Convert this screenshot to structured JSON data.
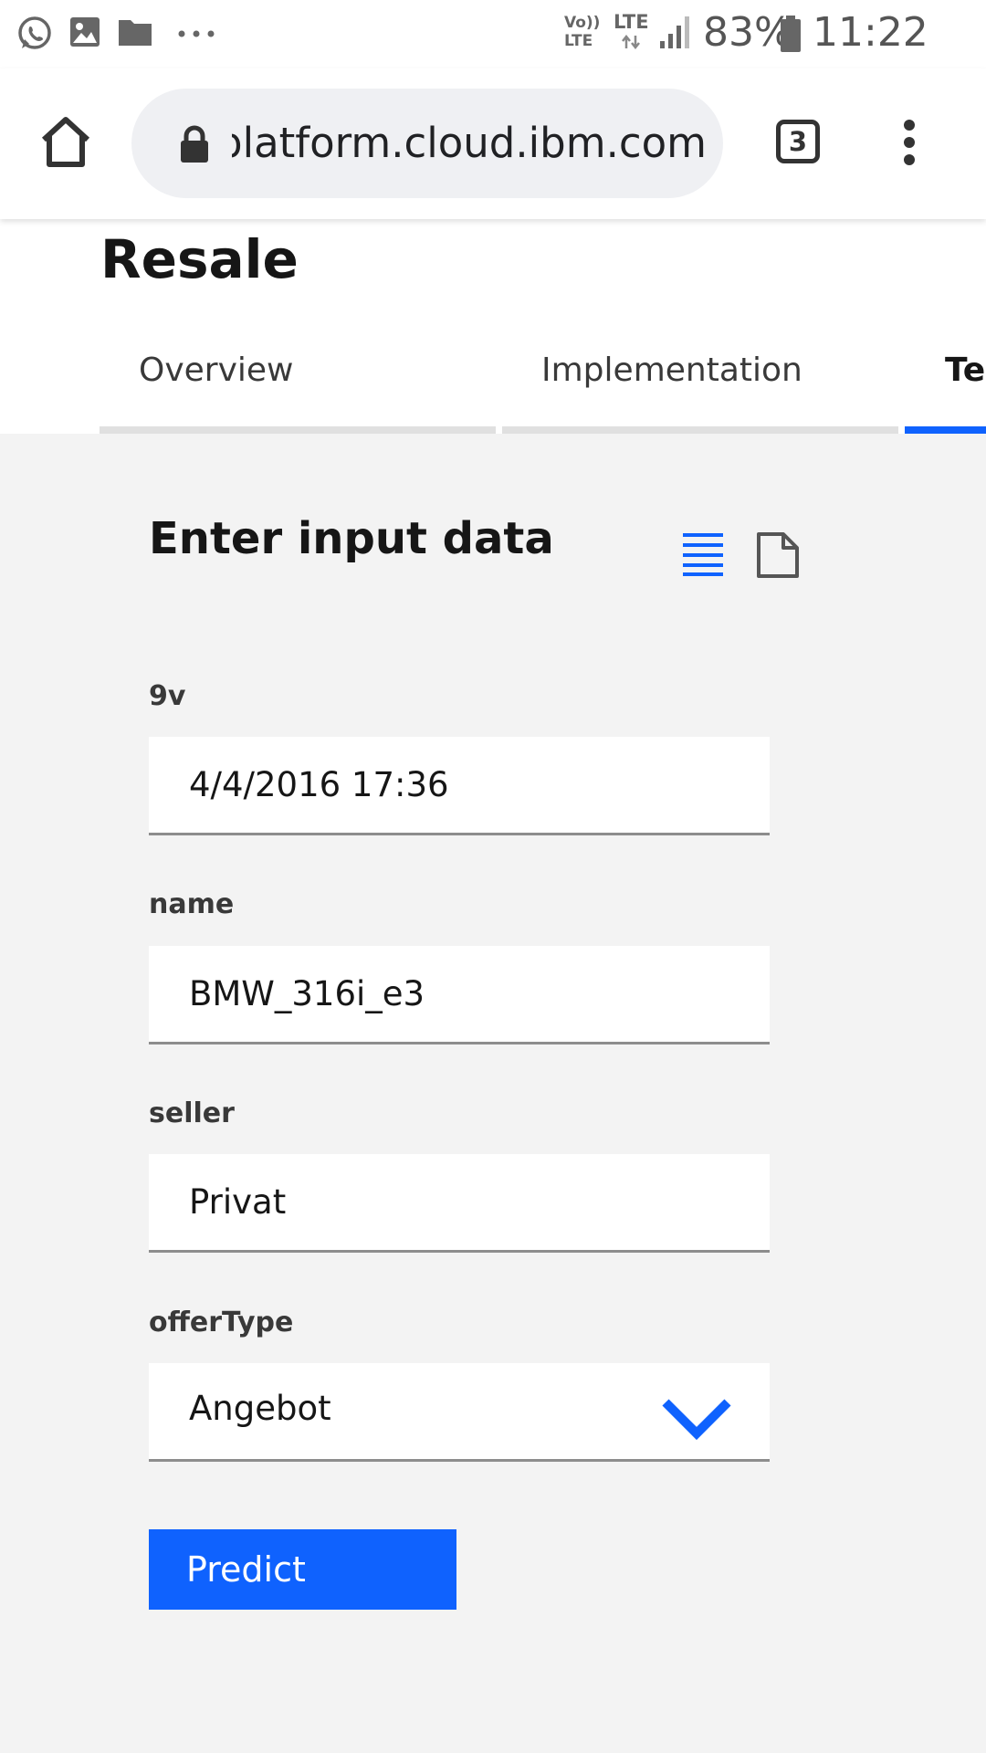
{
  "status_bar": {
    "notification_icons": [
      "whatsapp-icon",
      "image-icon",
      "folder-icon",
      "more-horiz-icon"
    ],
    "volte_top": "Vo))",
    "volte_bottom": "LTE",
    "lte_label": "LTE",
    "battery_percent": "83%",
    "time": "11:22 am"
  },
  "browser": {
    "home_icon": "home-icon",
    "lock_icon": "lock-icon",
    "url": "dataplatform.cloud.ibm.com",
    "tab_count": "3",
    "menu_icon": "more-vert-icon"
  },
  "page": {
    "title": "Resale",
    "tabs": [
      {
        "label": "Overview",
        "active": false
      },
      {
        "label": "Implementation",
        "active": false
      },
      {
        "label": "Test",
        "active": true
      }
    ]
  },
  "form": {
    "title": "Enter input data",
    "view_icons": [
      "list-view-icon",
      "json-file-icon"
    ],
    "fields": [
      {
        "label": "9v",
        "value": "4/4/2016 17:36"
      },
      {
        "label": "name",
        "value": "BMW_316i_e3"
      },
      {
        "label": "seller",
        "value": "Privat"
      }
    ],
    "select": {
      "label": "offerType",
      "value": "Angebot"
    },
    "predict_label": "Predict"
  },
  "colors": {
    "accent": "#0f62fe",
    "page_bg": "#f3f3f3",
    "text": "#161616"
  }
}
